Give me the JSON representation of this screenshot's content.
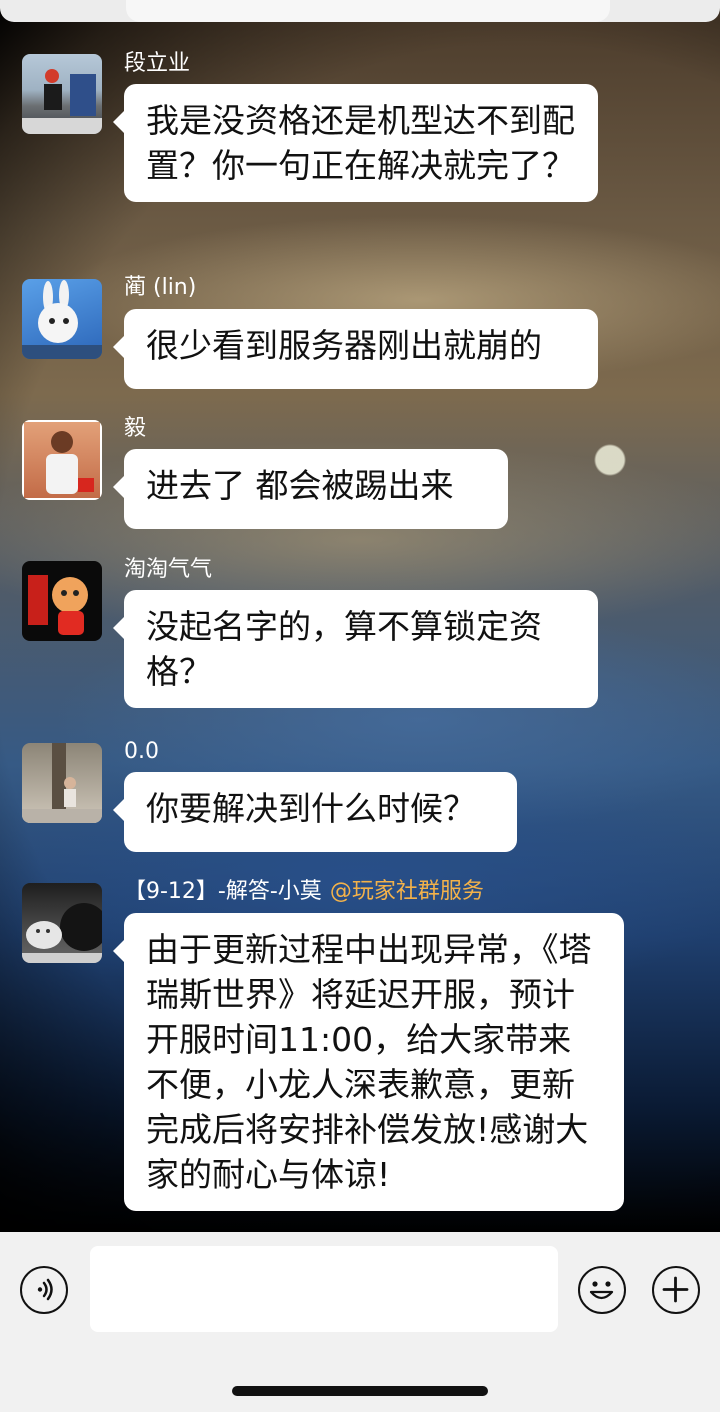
{
  "messages": [
    {
      "sender": "段立业",
      "text": "我是没资格还是机型达不到配置？你一句正在解决就完了？"
    },
    {
      "sender": "蔺 (lin)",
      "text": "很少看到服务器刚出就崩的"
    },
    {
      "sender": "毅",
      "text": "进去了 都会被踢出来"
    },
    {
      "sender": "淘淘气气",
      "text": "没起名字的，算不算锁定资格？"
    },
    {
      "sender": "0.0",
      "text": "你要解决到什么时候？"
    },
    {
      "sender": "【9-12】-解答-小莫",
      "tag": "@玩家社群服务",
      "text": "由于更新过程中出现异常，《塔瑞斯世界》将延迟开服，预计开服时间11:00，给大家带来不便，小龙人深表歉意，更新完成后将安排补偿发放!感谢大家的耐心与体谅!"
    }
  ],
  "icons": {
    "voice": "voice-icon",
    "emoji": "emoji-icon",
    "plus": "plus-icon"
  }
}
